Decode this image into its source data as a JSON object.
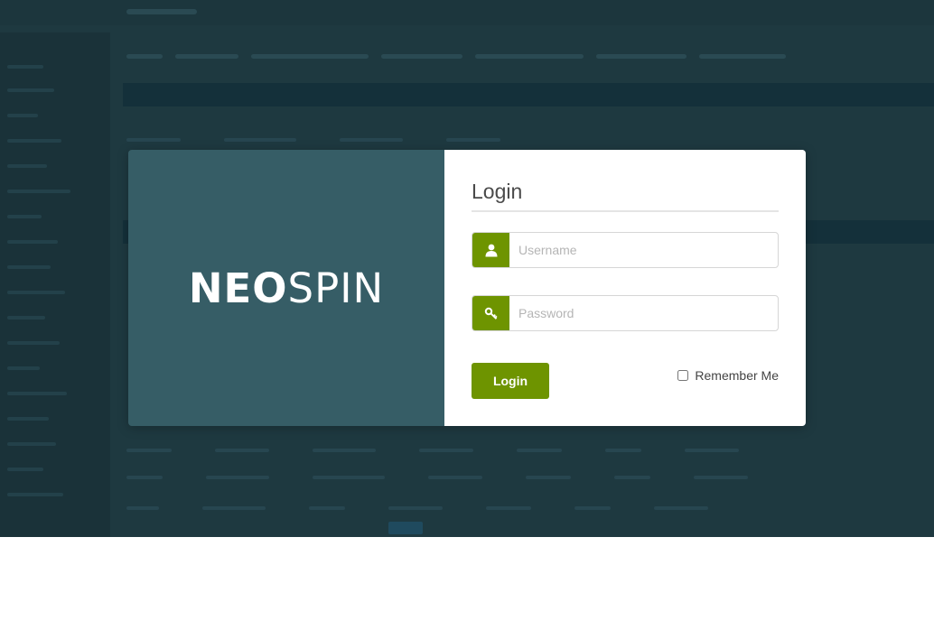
{
  "brand": {
    "logo_part_bold": "NEO",
    "logo_part_light": "SPIN"
  },
  "login_form": {
    "title": "Login",
    "username": {
      "value": "",
      "placeholder": "Username",
      "icon": "user-icon"
    },
    "password": {
      "value": "",
      "placeholder": "Password",
      "icon": "key-icon"
    },
    "submit_label": "Login",
    "remember_label": "Remember Me",
    "remember_checked": false
  },
  "colors": {
    "brand_panel": "#365d66",
    "accent_green": "#6e9400",
    "backdrop": "#1e3940"
  }
}
